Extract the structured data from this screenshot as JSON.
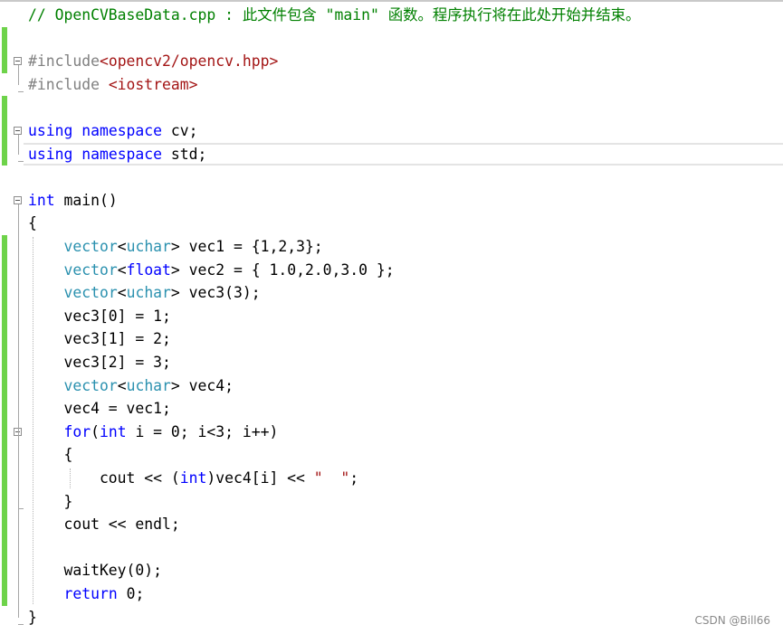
{
  "editor": {
    "lines": [
      [
        {
          "t": "// OpenCVBaseData.cpp : 此文件包含 \"main\" 函数。程序执行将在此处开始并结束。",
          "c": "cmt"
        }
      ],
      [],
      [
        {
          "t": "#include",
          "c": "pp"
        },
        {
          "t": "<opencv2/opencv.hpp>",
          "c": "str"
        }
      ],
      [
        {
          "t": "#include ",
          "c": "pp"
        },
        {
          "t": "<iostream>",
          "c": "str"
        }
      ],
      [],
      [
        {
          "t": "using",
          "c": "kw"
        },
        {
          "t": " "
        },
        {
          "t": "namespace",
          "c": "kw"
        },
        {
          "t": " cv;"
        }
      ],
      [
        {
          "t": "using",
          "c": "kw"
        },
        {
          "t": " "
        },
        {
          "t": "namespace",
          "c": "kw"
        },
        {
          "t": " std;"
        }
      ],
      [],
      [
        {
          "t": "int",
          "c": "kw"
        },
        {
          "t": " main()"
        }
      ],
      [
        {
          "t": "{"
        }
      ],
      [
        {
          "t": "    "
        },
        {
          "t": "vector",
          "c": "typ"
        },
        {
          "t": "<"
        },
        {
          "t": "uchar",
          "c": "typ"
        },
        {
          "t": "> vec1 = {1,2,3};"
        }
      ],
      [
        {
          "t": "    "
        },
        {
          "t": "vector",
          "c": "typ"
        },
        {
          "t": "<"
        },
        {
          "t": "float",
          "c": "kw"
        },
        {
          "t": "> vec2 = { 1.0,2.0,3.0 };"
        }
      ],
      [
        {
          "t": "    "
        },
        {
          "t": "vector",
          "c": "typ"
        },
        {
          "t": "<"
        },
        {
          "t": "uchar",
          "c": "typ"
        },
        {
          "t": "> vec3(3);"
        }
      ],
      [
        {
          "t": "    vec3[0] = 1;"
        }
      ],
      [
        {
          "t": "    vec3[1] = 2;"
        }
      ],
      [
        {
          "t": "    vec3[2] = 3;"
        }
      ],
      [
        {
          "t": "    "
        },
        {
          "t": "vector",
          "c": "typ"
        },
        {
          "t": "<"
        },
        {
          "t": "uchar",
          "c": "typ"
        },
        {
          "t": "> vec4;"
        }
      ],
      [
        {
          "t": "    vec4 = vec1;"
        }
      ],
      [
        {
          "t": "    "
        },
        {
          "t": "for",
          "c": "kw"
        },
        {
          "t": "("
        },
        {
          "t": "int",
          "c": "kw"
        },
        {
          "t": " i = 0; i<3; i++)"
        }
      ],
      [
        {
          "t": "    {"
        }
      ],
      [
        {
          "t": "        cout << ("
        },
        {
          "t": "int",
          "c": "kw"
        },
        {
          "t": ")vec4[i] << "
        },
        {
          "t": "\"  \"",
          "c": "str"
        },
        {
          "t": ";"
        }
      ],
      [
        {
          "t": "    }"
        }
      ],
      [
        {
          "t": "    cout << endl;"
        }
      ],
      [],
      [
        {
          "t": "    waitKey(0);"
        }
      ],
      [
        {
          "t": "    "
        },
        {
          "t": "return",
          "c": "kw"
        },
        {
          "t": " 0;"
        }
      ],
      [
        {
          "t": "}"
        }
      ]
    ],
    "current_line": 6
  },
  "watermark": "CSDN @Bill66"
}
